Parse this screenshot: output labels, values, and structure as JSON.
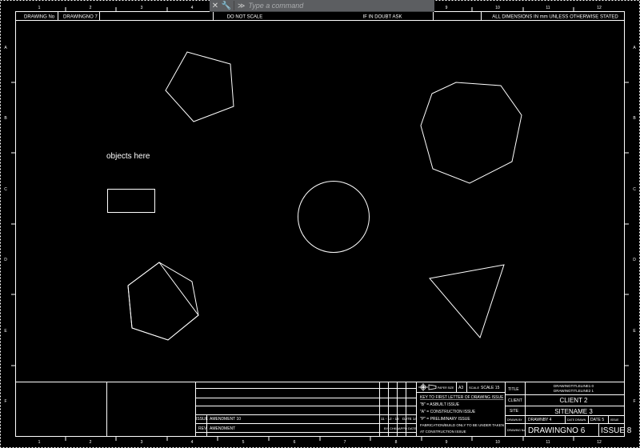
{
  "command_bar": {
    "close_glyph": "✕",
    "customize_glyph": "🔧",
    "prompt_glyph": "≫",
    "placeholder": "Type a command"
  },
  "header_strip": {
    "drawing_no_label": "DRAWING No",
    "drawing_no_value": "DRAWINGNO 7",
    "do_not_scale": "DO NOT SCALE",
    "if_in_doubt": "IF IN DOUBT ASK",
    "dimensions_note": "ALL DIMENSIONS IN mm UNLESS OTHERWISE STATED"
  },
  "canvas": {
    "annotation": "objects here"
  },
  "border_numbers": [
    "1",
    "2",
    "3",
    "4",
    "5",
    "6",
    "7",
    "8",
    "9",
    "10",
    "11",
    "12"
  ],
  "border_letters": [
    "A",
    "B",
    "C",
    "D",
    "E",
    "F"
  ],
  "revision_table": {
    "issue_label": "ISSUE",
    "issue_value": "AMENDMENT 10",
    "rev_label": "REV",
    "rev_value": "AMENDMENT",
    "date_value": "11 - 12 - 13",
    "date_label": "DATE",
    "extra_value": "DATE 14",
    "by_label": "BY",
    "chkd_label": "CHKD",
    "appd_label": "APPD",
    "date_col_label": "DATE"
  },
  "key_panel": {
    "paper_size_label": "PAPER SIZE",
    "paper_size_value": "A3",
    "scale_label": "SCALE",
    "scale_value": "SCALE 15",
    "key_title": "KEY TO FIRST LETTER OF DRAWING ISSUE",
    "key_lines": [
      "\"B\" = ASBUILT ISSUE",
      "\"A\" = CONSTRUCTION ISSUE",
      "\"P\" = PRELIMINARY ISSUE"
    ],
    "fabrication_note_1": "FABRICATION/BUILD ONLY TO BE UNDER TAKEN",
    "fabrication_note_2": "AT CONSTRUCTION ISSUE"
  },
  "title_block": {
    "title_label": "TITLE",
    "title_line_1": "DRAWINGTITLELINE1 0",
    "title_line_2": "DRAWINGTITLELINE2 1",
    "client_label": "CLIENT",
    "client_value": "CLIENT 2",
    "site_label": "SITE",
    "site_value": "SITENAME 3",
    "drawn_by_label": "DRAWN BY",
    "drawn_by_value": "DRAWNBY 4",
    "date_drawn_label": "DATE DRAWN",
    "date_drawn_value": "DATE 5",
    "issue_small_label": "ISSUE",
    "drawing_no_label": "DRAWING No.",
    "drawing_no_value": "DRAWINGNO 6",
    "issue_value": "ISSUE 8"
  }
}
